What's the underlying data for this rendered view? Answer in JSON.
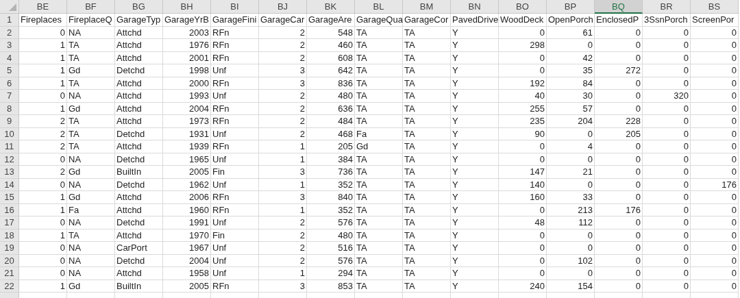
{
  "sheet": {
    "columns": [
      {
        "label": "BE",
        "kind": "number",
        "selected": false
      },
      {
        "label": "BF",
        "kind": "text",
        "selected": false
      },
      {
        "label": "BG",
        "kind": "text",
        "selected": false
      },
      {
        "label": "BH",
        "kind": "number",
        "selected": false
      },
      {
        "label": "BI",
        "kind": "text",
        "selected": false
      },
      {
        "label": "BJ",
        "kind": "number",
        "selected": false
      },
      {
        "label": "BK",
        "kind": "number",
        "selected": false
      },
      {
        "label": "BL",
        "kind": "text",
        "selected": false
      },
      {
        "label": "BM",
        "kind": "text",
        "selected": false
      },
      {
        "label": "BN",
        "kind": "text",
        "selected": false
      },
      {
        "label": "BO",
        "kind": "number",
        "selected": false
      },
      {
        "label": "BP",
        "kind": "number",
        "selected": false
      },
      {
        "label": "BQ",
        "kind": "number",
        "selected": true
      },
      {
        "label": "BR",
        "kind": "number",
        "selected": false
      },
      {
        "label": "BS",
        "kind": "number",
        "selected": false
      }
    ],
    "field_row": {
      "number": "1",
      "cells": [
        "Fireplaces",
        "FireplaceQ",
        "GarageTyp",
        "GarageYrB",
        "GarageFini",
        "GarageCar",
        "GarageAre",
        "GarageQua",
        "GarageCor",
        "PavedDrive",
        "WoodDeck",
        "OpenPorch",
        "EnclosedP",
        "3SsnPorch",
        "ScreenPor"
      ]
    },
    "rows": [
      {
        "number": "2",
        "cells": [
          "0",
          "NA",
          "Attchd",
          "2003",
          "RFn",
          "2",
          "548",
          "TA",
          "TA",
          "Y",
          "0",
          "61",
          "0",
          "0",
          "0"
        ]
      },
      {
        "number": "3",
        "cells": [
          "1",
          "TA",
          "Attchd",
          "1976",
          "RFn",
          "2",
          "460",
          "TA",
          "TA",
          "Y",
          "298",
          "0",
          "0",
          "0",
          "0"
        ]
      },
      {
        "number": "4",
        "cells": [
          "1",
          "TA",
          "Attchd",
          "2001",
          "RFn",
          "2",
          "608",
          "TA",
          "TA",
          "Y",
          "0",
          "42",
          "0",
          "0",
          "0"
        ]
      },
      {
        "number": "5",
        "cells": [
          "1",
          "Gd",
          "Detchd",
          "1998",
          "Unf",
          "3",
          "642",
          "TA",
          "TA",
          "Y",
          "0",
          "35",
          "272",
          "0",
          "0"
        ]
      },
      {
        "number": "6",
        "cells": [
          "1",
          "TA",
          "Attchd",
          "2000",
          "RFn",
          "3",
          "836",
          "TA",
          "TA",
          "Y",
          "192",
          "84",
          "0",
          "0",
          "0"
        ]
      },
      {
        "number": "7",
        "cells": [
          "0",
          "NA",
          "Attchd",
          "1993",
          "Unf",
          "2",
          "480",
          "TA",
          "TA",
          "Y",
          "40",
          "30",
          "0",
          "320",
          "0"
        ]
      },
      {
        "number": "8",
        "cells": [
          "1",
          "Gd",
          "Attchd",
          "2004",
          "RFn",
          "2",
          "636",
          "TA",
          "TA",
          "Y",
          "255",
          "57",
          "0",
          "0",
          "0"
        ]
      },
      {
        "number": "9",
        "cells": [
          "2",
          "TA",
          "Attchd",
          "1973",
          "RFn",
          "2",
          "484",
          "TA",
          "TA",
          "Y",
          "235",
          "204",
          "228",
          "0",
          "0"
        ]
      },
      {
        "number": "10",
        "cells": [
          "2",
          "TA",
          "Detchd",
          "1931",
          "Unf",
          "2",
          "468",
          "Fa",
          "TA",
          "Y",
          "90",
          "0",
          "205",
          "0",
          "0"
        ]
      },
      {
        "number": "11",
        "cells": [
          "2",
          "TA",
          "Attchd",
          "1939",
          "RFn",
          "1",
          "205",
          "Gd",
          "TA",
          "Y",
          "0",
          "4",
          "0",
          "0",
          "0"
        ]
      },
      {
        "number": "12",
        "cells": [
          "0",
          "NA",
          "Detchd",
          "1965",
          "Unf",
          "1",
          "384",
          "TA",
          "TA",
          "Y",
          "0",
          "0",
          "0",
          "0",
          "0"
        ]
      },
      {
        "number": "13",
        "cells": [
          "2",
          "Gd",
          "BuiltIn",
          "2005",
          "Fin",
          "3",
          "736",
          "TA",
          "TA",
          "Y",
          "147",
          "21",
          "0",
          "0",
          "0"
        ]
      },
      {
        "number": "14",
        "cells": [
          "0",
          "NA",
          "Detchd",
          "1962",
          "Unf",
          "1",
          "352",
          "TA",
          "TA",
          "Y",
          "140",
          "0",
          "0",
          "0",
          "176"
        ]
      },
      {
        "number": "15",
        "cells": [
          "1",
          "Gd",
          "Attchd",
          "2006",
          "RFn",
          "3",
          "840",
          "TA",
          "TA",
          "Y",
          "160",
          "33",
          "0",
          "0",
          "0"
        ]
      },
      {
        "number": "16",
        "cells": [
          "1",
          "Fa",
          "Attchd",
          "1960",
          "RFn",
          "1",
          "352",
          "TA",
          "TA",
          "Y",
          "0",
          "213",
          "176",
          "0",
          "0"
        ]
      },
      {
        "number": "17",
        "cells": [
          "0",
          "NA",
          "Detchd",
          "1991",
          "Unf",
          "2",
          "576",
          "TA",
          "TA",
          "Y",
          "48",
          "112",
          "0",
          "0",
          "0"
        ]
      },
      {
        "number": "18",
        "cells": [
          "1",
          "TA",
          "Attchd",
          "1970",
          "Fin",
          "2",
          "480",
          "TA",
          "TA",
          "Y",
          "0",
          "0",
          "0",
          "0",
          "0"
        ]
      },
      {
        "number": "19",
        "cells": [
          "0",
          "NA",
          "CarPort",
          "1967",
          "Unf",
          "2",
          "516",
          "TA",
          "TA",
          "Y",
          "0",
          "0",
          "0",
          "0",
          "0"
        ]
      },
      {
        "number": "20",
        "cells": [
          "0",
          "NA",
          "Detchd",
          "2004",
          "Unf",
          "2",
          "576",
          "TA",
          "TA",
          "Y",
          "0",
          "102",
          "0",
          "0",
          "0"
        ]
      },
      {
        "number": "21",
        "cells": [
          "0",
          "NA",
          "Attchd",
          "1958",
          "Unf",
          "1",
          "294",
          "TA",
          "TA",
          "Y",
          "0",
          "0",
          "0",
          "0",
          "0"
        ]
      },
      {
        "number": "22",
        "cells": [
          "1",
          "Gd",
          "BuiltIn",
          "2005",
          "RFn",
          "3",
          "853",
          "TA",
          "TA",
          "Y",
          "240",
          "154",
          "0",
          "0",
          "0"
        ]
      }
    ]
  }
}
